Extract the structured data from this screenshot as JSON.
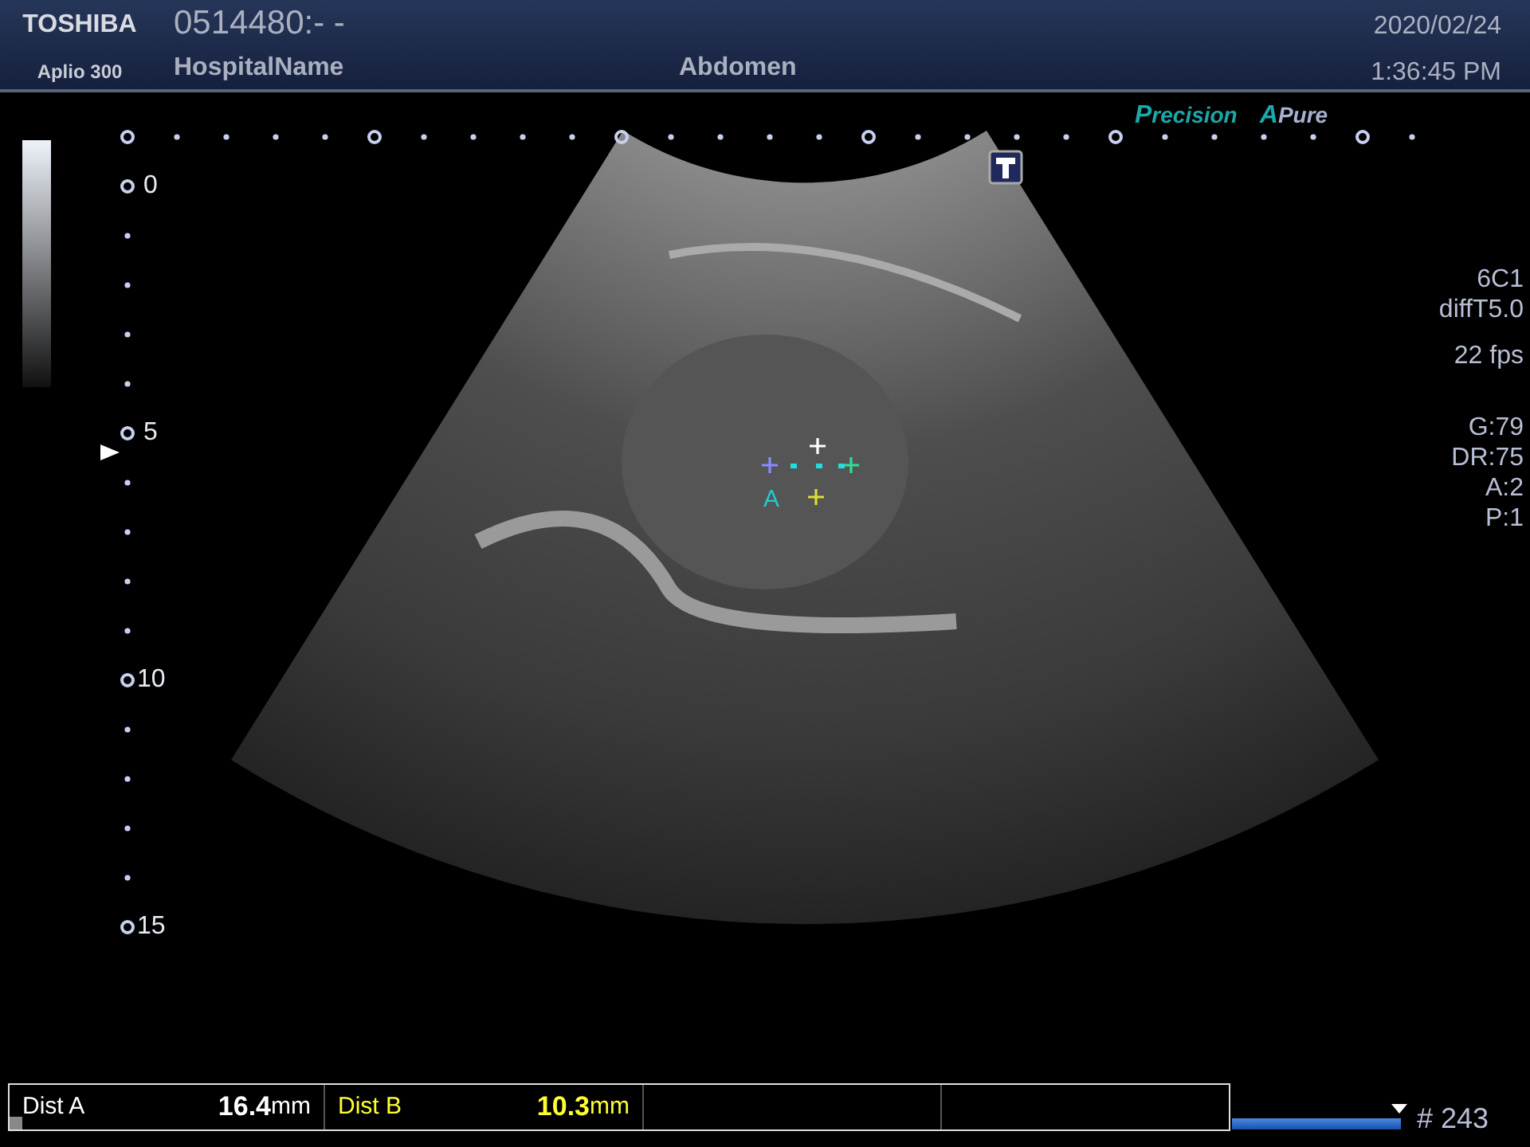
{
  "header": {
    "brand": "TOSHIBA",
    "model": "Aplio 300",
    "patient_id": "0514480:- -",
    "hospital": "HospitalName",
    "preset": "Abdomen",
    "date": "2020/02/24",
    "time": "1:36:45 PM"
  },
  "modes": [
    {
      "prefix": "P",
      "label": "recision"
    },
    {
      "prefix": "A",
      "label": "Pure"
    }
  ],
  "depth_labels": [
    "0",
    "5",
    "10",
    "15"
  ],
  "params": [
    [
      "6C1",
      "diffT5.0"
    ],
    [
      "22 fps"
    ],
    [
      "G:79",
      "DR:75",
      "A:2",
      "P:1"
    ]
  ],
  "caliper_label": "A",
  "measurements": [
    {
      "label": "Dist A",
      "value": "16.4",
      "unit": "mm",
      "color": "#ffffff"
    },
    {
      "label": "Dist B",
      "value": "10.3",
      "unit": "mm",
      "color": "#ffff33"
    }
  ],
  "cine": {
    "frame": "# 243"
  }
}
